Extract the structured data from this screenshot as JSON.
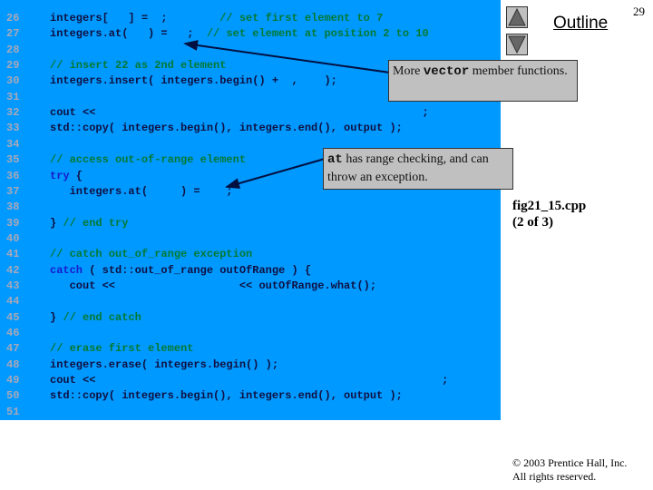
{
  "code_lines": [
    {
      "n": "26",
      "segs": [
        [
          "integers[   ] =  ;        ",
          ""
        ],
        [
          "// set first element to 7",
          "c"
        ]
      ]
    },
    {
      "n": "27",
      "segs": [
        [
          "integers.at(   ) =   ;  ",
          ""
        ],
        [
          "// set element at position 2 to 10",
          "c"
        ]
      ]
    },
    {
      "n": "28",
      "segs": []
    },
    {
      "n": "29",
      "segs": [
        [
          "// insert 22 as 2nd element",
          "c"
        ]
      ]
    },
    {
      "n": "30",
      "segs": [
        [
          "integers.insert( integers.begin() +  ,    );",
          ""
        ]
      ]
    },
    {
      "n": "31",
      "segs": []
    },
    {
      "n": "32",
      "segs": [
        [
          "cout <<                                                  ;",
          ""
        ]
      ]
    },
    {
      "n": "33",
      "segs": [
        [
          "std::copy( integers.begin(), integers.end(), output );",
          ""
        ]
      ]
    },
    {
      "n": "34",
      "segs": []
    },
    {
      "n": "35",
      "segs": [
        [
          "// access out-of-range element",
          "c"
        ]
      ]
    },
    {
      "n": "36",
      "segs": [
        [
          "try",
          "k"
        ],
        [
          " {",
          ""
        ]
      ]
    },
    {
      "n": "37",
      "segs": [
        [
          "   integers.at(     ) =    ;",
          ""
        ]
      ]
    },
    {
      "n": "38",
      "segs": []
    },
    {
      "n": "39",
      "segs": [
        [
          "} ",
          ""
        ],
        [
          "// end try",
          "c"
        ]
      ]
    },
    {
      "n": "40",
      "segs": []
    },
    {
      "n": "41",
      "segs": [
        [
          "// catch out_of_range exception",
          "c"
        ]
      ]
    },
    {
      "n": "42",
      "segs": [
        [
          "catch",
          "k"
        ],
        [
          " ( std::out_of_range outOfRange ) {",
          ""
        ]
      ]
    },
    {
      "n": "43",
      "segs": [
        [
          "   cout <<                   << outOfRange.what();",
          ""
        ]
      ]
    },
    {
      "n": "44",
      "segs": []
    },
    {
      "n": "45",
      "segs": [
        [
          "} ",
          ""
        ],
        [
          "// end catch",
          "c"
        ]
      ]
    },
    {
      "n": "46",
      "segs": []
    },
    {
      "n": "47",
      "segs": [
        [
          "// erase first element",
          "c"
        ]
      ]
    },
    {
      "n": "48",
      "segs": [
        [
          "integers.erase( integers.begin() );",
          ""
        ]
      ]
    },
    {
      "n": "49",
      "segs": [
        [
          "cout <<                                                     ;",
          ""
        ]
      ]
    },
    {
      "n": "50",
      "segs": [
        [
          "std::copy( integers.begin(), integers.end(), output );",
          ""
        ]
      ]
    },
    {
      "n": "51",
      "segs": []
    }
  ],
  "callouts": {
    "vector": {
      "pre": "More ",
      "mono": "vector",
      "post": " member functions."
    },
    "at": {
      "mono": "at",
      "post": " has range checking, and can throw an exception."
    }
  },
  "nav": {
    "outline": "Outline",
    "page": "29",
    "up_icon": "triangle-up",
    "down_icon": "triangle-down"
  },
  "file": {
    "name": "fig21_15.cpp",
    "part": "(2 of 3)"
  },
  "copyright": {
    "line1": "© 2003 Prentice Hall, Inc.",
    "line2": "All rights reserved."
  },
  "colors": {
    "code_bg": "#0099ff",
    "comment": "#007a33",
    "keyword": "#1a1acc",
    "callout_bg": "#c0c0c0"
  }
}
